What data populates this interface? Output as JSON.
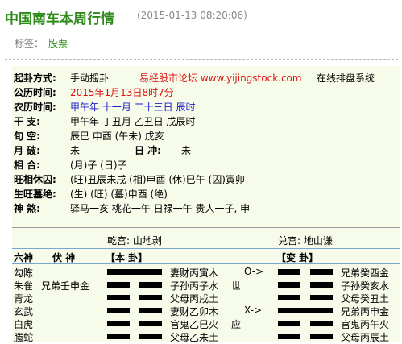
{
  "header": {
    "title": "中国南车本周行情",
    "datetime": "(2015-01-13 08:20:06)",
    "tags_label": "标签：",
    "tag": "股票"
  },
  "info": {
    "method_label": "起卦方式:",
    "method_value": "手动摇卦",
    "forum_link": "易经股市论坛 www.yijingstock.com",
    "online_suffix": "在线排盘系统",
    "gongli_label": "公历时间:",
    "gongli_value": "2015年1月13日8时7分",
    "nongli_label": "农历时间:",
    "nongli_value": "甲午年 十一月 二十三日 辰时",
    "ganzhi_label": "干   支:",
    "ganzhi_value": "甲午年 丁丑月 乙丑日 戊辰时",
    "xunkong_label": "旬   空:",
    "xunkong_value": "辰巳    申酉    (午未)     戊亥",
    "yuepo_label": "月   破:",
    "yuepo_value": "未",
    "richong_label": "日   冲:",
    "richong_value": "未",
    "xianghe_label": "相   合:",
    "xianghe_value": "(月)子          (日)子",
    "wangxiang_label": "旺相休囚:",
    "wangxiang_value": "(旺)丑辰未戌    (相)申酉    (休)巳午    (囚)寅卯",
    "shengwang_label": "生旺墓绝:",
    "shengwang_value": "(生)    (旺)    (墓)申酉    (绝)",
    "shensha_label": "神   煞:",
    "shensha_value": "驿马一亥  桃花一午  日禄一午  贵人一子, 申"
  },
  "palaces": {
    "ben": "乾宫: 山地剥",
    "bian": "兑宫: 地山谦"
  },
  "table_header": {
    "liushen": "六神",
    "fushen": "伏    神",
    "ben_gua": "【本    卦】",
    "bian_gua": "【变    卦】"
  },
  "rows": [
    {
      "shen": "勾陈",
      "fu": "",
      "ben": "妻财丙寅木",
      "shiying": "",
      "mark": "O->",
      "bian": "兄弟癸酉金",
      "ben_yao": "yang",
      "bian_yao": "yin"
    },
    {
      "shen": "朱雀",
      "fu": "兄弟壬申金",
      "ben": "子孙丙子水",
      "shiying": "世",
      "mark": "",
      "bian": "子孙癸亥水",
      "ben_yao": "yin",
      "bian_yao": "yin"
    },
    {
      "shen": "青龙",
      "fu": "",
      "ben": "父母丙戌土",
      "shiying": "",
      "mark": "",
      "bian": "父母癸丑土",
      "ben_yao": "yin",
      "bian_yao": "yin"
    },
    {
      "shen": "玄武",
      "fu": "",
      "ben": "妻财乙卯木",
      "shiying": "",
      "mark": "X->",
      "bian": "兄弟丙申金",
      "ben_yao": "yin",
      "bian_yao": "yang"
    },
    {
      "shen": "白虎",
      "fu": "",
      "ben": "官鬼乙巳火",
      "shiying": "应",
      "mark": "",
      "bian": "官鬼丙午火",
      "ben_yao": "yin",
      "bian_yao": "yin"
    },
    {
      "shen": "螣蛇",
      "fu": "",
      "ben": "父母乙未土",
      "shiying": "",
      "mark": "",
      "bian": "父母丙辰土",
      "ben_yao": "yin",
      "bian_yao": "yin"
    }
  ],
  "colors": {
    "title_green": "#2e8b1a",
    "date_gray": "#888888",
    "red": "#dd1111",
    "blue": "#1b1bcc",
    "panel_bg": "#f7fbea"
  }
}
